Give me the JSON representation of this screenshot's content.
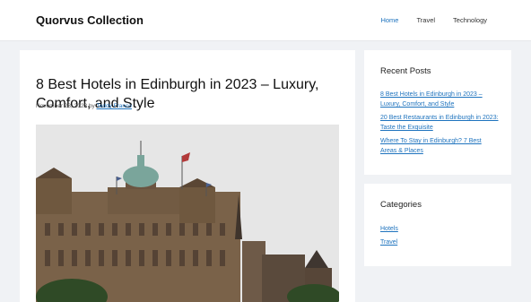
{
  "site": {
    "title": "Quorvus Collection"
  },
  "nav": {
    "items": [
      {
        "label": "Home"
      },
      {
        "label": "Travel"
      },
      {
        "label": "Technology"
      }
    ]
  },
  "post": {
    "title": "8 Best Hotels in Edinburgh in 2023 – Luxury, Comfort, and Style",
    "date": "November 28, 2023",
    "by": "by",
    "author": "Teddy Franco"
  },
  "sidebar": {
    "recent": {
      "heading": "Recent Posts",
      "items": [
        {
          "label": "8 Best Hotels in Edinburgh in 2023 – Luxury, Comfort, and Style"
        },
        {
          "label": "20 Best Restaurants in Edinburgh in 2023: Taste the Exquisite"
        },
        {
          "label": "Where To Stay in Edinburgh? 7 Best Areas & Places"
        }
      ]
    },
    "categories": {
      "heading": "Categories",
      "items": [
        {
          "label": "Hotels"
        },
        {
          "label": "Travel"
        }
      ]
    }
  },
  "colors": {
    "accent": "#1e73be",
    "background": "#f0f2f5",
    "sky": "#e6e6e6",
    "stone": "#6b5440"
  }
}
